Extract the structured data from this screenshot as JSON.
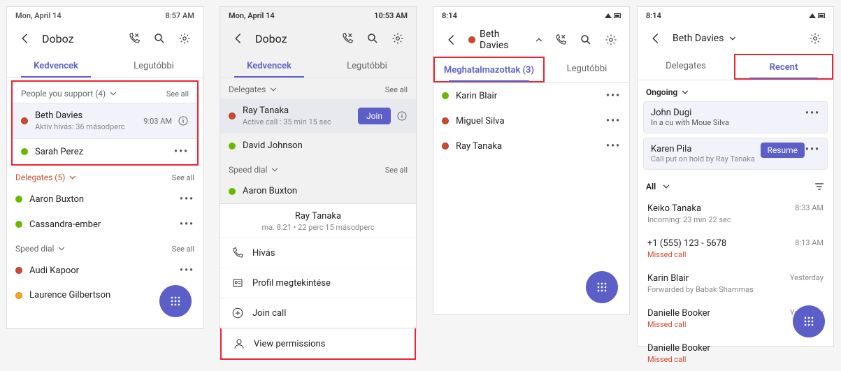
{
  "phone1": {
    "status_left": "Mon, April 14",
    "status_right": "8:57 AM",
    "title": "Doboz",
    "tabs": {
      "left": "Kedvencek",
      "right": "Legutóbbi"
    },
    "section_people": {
      "label": "People you support (4)",
      "seeall": "See all"
    },
    "beth": {
      "name": "Beth Davies",
      "sub": "Aktív hívás: 36 másodperc",
      "time": "9:03 AM"
    },
    "sarah": {
      "name": "Sarah Perez"
    },
    "section_delegates": {
      "label": "Delegates (5)",
      "seeall": "See all"
    },
    "aaron": {
      "name": "Aaron Buxton"
    },
    "cassandra": {
      "name": "Cassandra-ember"
    },
    "section_speed": {
      "label": "Speed dial",
      "seeall": "See all"
    },
    "audi": {
      "name": "Audi Kapoor"
    },
    "laurence": {
      "name": "Laurence Gilbertson"
    }
  },
  "phone2": {
    "status_left": "Mon, April 14",
    "status_right": "10:53 AM",
    "title": "Doboz",
    "tabs": {
      "left": "Kedvencek",
      "right": "Legutóbbi"
    },
    "section_delegates": {
      "label": "Delegates",
      "seeall": "See all"
    },
    "ray": {
      "name": "Ray Tanaka",
      "sub": "Active call : 35 min 15 sec",
      "join": "Join"
    },
    "david": {
      "name": "David Johnson"
    },
    "section_speed": {
      "label": "Speed dial",
      "seeall": "See all"
    },
    "aaron": {
      "name": "Aaron Buxton"
    },
    "sheet": {
      "name": "Ray Tanaka",
      "sub": "ma. 8:21 • 22 perc 15 másodperc",
      "item1": "Hívás",
      "item2": "Profil megtekintése",
      "item3": "Join call",
      "item4": "View permissions"
    }
  },
  "phone3": {
    "status_left": "8:14",
    "presence_name": "Beth Davies",
    "tabs": {
      "left": "Meghatalmazottak (3)",
      "right": "Legutóbbi"
    },
    "karin": {
      "name": "Karin Blair"
    },
    "miguel": {
      "name": "Miguel Silva"
    },
    "ray": {
      "name": "Ray Tanaka"
    }
  },
  "phone4": {
    "status_left": "8:14",
    "presence_name": "Beth Davies",
    "tabs": {
      "left": "Delegates",
      "right": "Recent"
    },
    "ongoing_label": "Ongoing",
    "john": {
      "name": "John Dugi",
      "sub": "In a cu with Moue Silva"
    },
    "karen": {
      "name": "Karen Pila",
      "sub": "Call put on hold by Ray Tanaka",
      "resume": "Resume"
    },
    "all_label": "All",
    "keiko": {
      "name": "Keiko Tanaka",
      "sub": "Incoming: 23 min 22 sec",
      "time": "8:33 AM"
    },
    "num": {
      "name": "+1 (555) 123 - 5678",
      "sub": "Missed call",
      "time": "8:13 AM"
    },
    "karin": {
      "name": "Karin Blair",
      "sub": "Forwarded by Babak Shammas",
      "time": "Yesterday"
    },
    "dan1": {
      "name": "Danielle Booker",
      "sub": "Missed call",
      "time": "Yesterday"
    },
    "dan2": {
      "name": "Danielle Booker",
      "sub": "Missed call"
    }
  }
}
